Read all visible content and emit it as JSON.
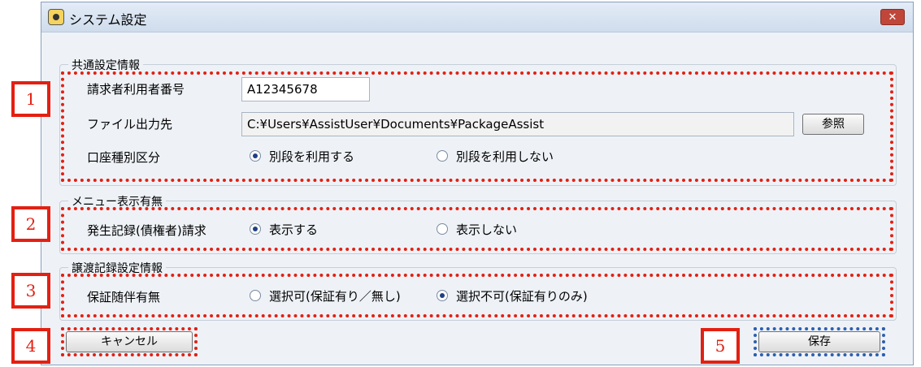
{
  "window": {
    "title": "システム設定",
    "close_label": "✕"
  },
  "sections": {
    "common": {
      "title": "共通設定情報",
      "requester_id_label": "請求者利用者番号",
      "requester_id_value": "A12345678",
      "output_label": "ファイル出力先",
      "output_value": "C:¥Users¥AssistUser¥Documents¥PackageAssist",
      "browse_label": "参照",
      "account_label": "口座種別区分",
      "account_option_use": "別段を利用する",
      "account_option_nouse": "別段を利用しない",
      "account_selected": "use"
    },
    "menu": {
      "title": "メニュー表示有無",
      "claim_label": "発生記録(債権者)請求",
      "show_option": "表示する",
      "hide_option": "表示しない",
      "selected": "show"
    },
    "transfer": {
      "title": "譲渡記録設定情報",
      "guarantee_label": "保証随伴有無",
      "option_selectable": "選択可(保証有り／無し)",
      "option_fixed": "選択不可(保証有りのみ)",
      "selected": "fixed"
    }
  },
  "buttons": {
    "cancel": "キャンセル",
    "save": "保存"
  },
  "markers": [
    "1",
    "2",
    "3",
    "4",
    "5"
  ],
  "colors": {
    "marker": "#e32012",
    "save_dots": "#2d5fb1"
  }
}
